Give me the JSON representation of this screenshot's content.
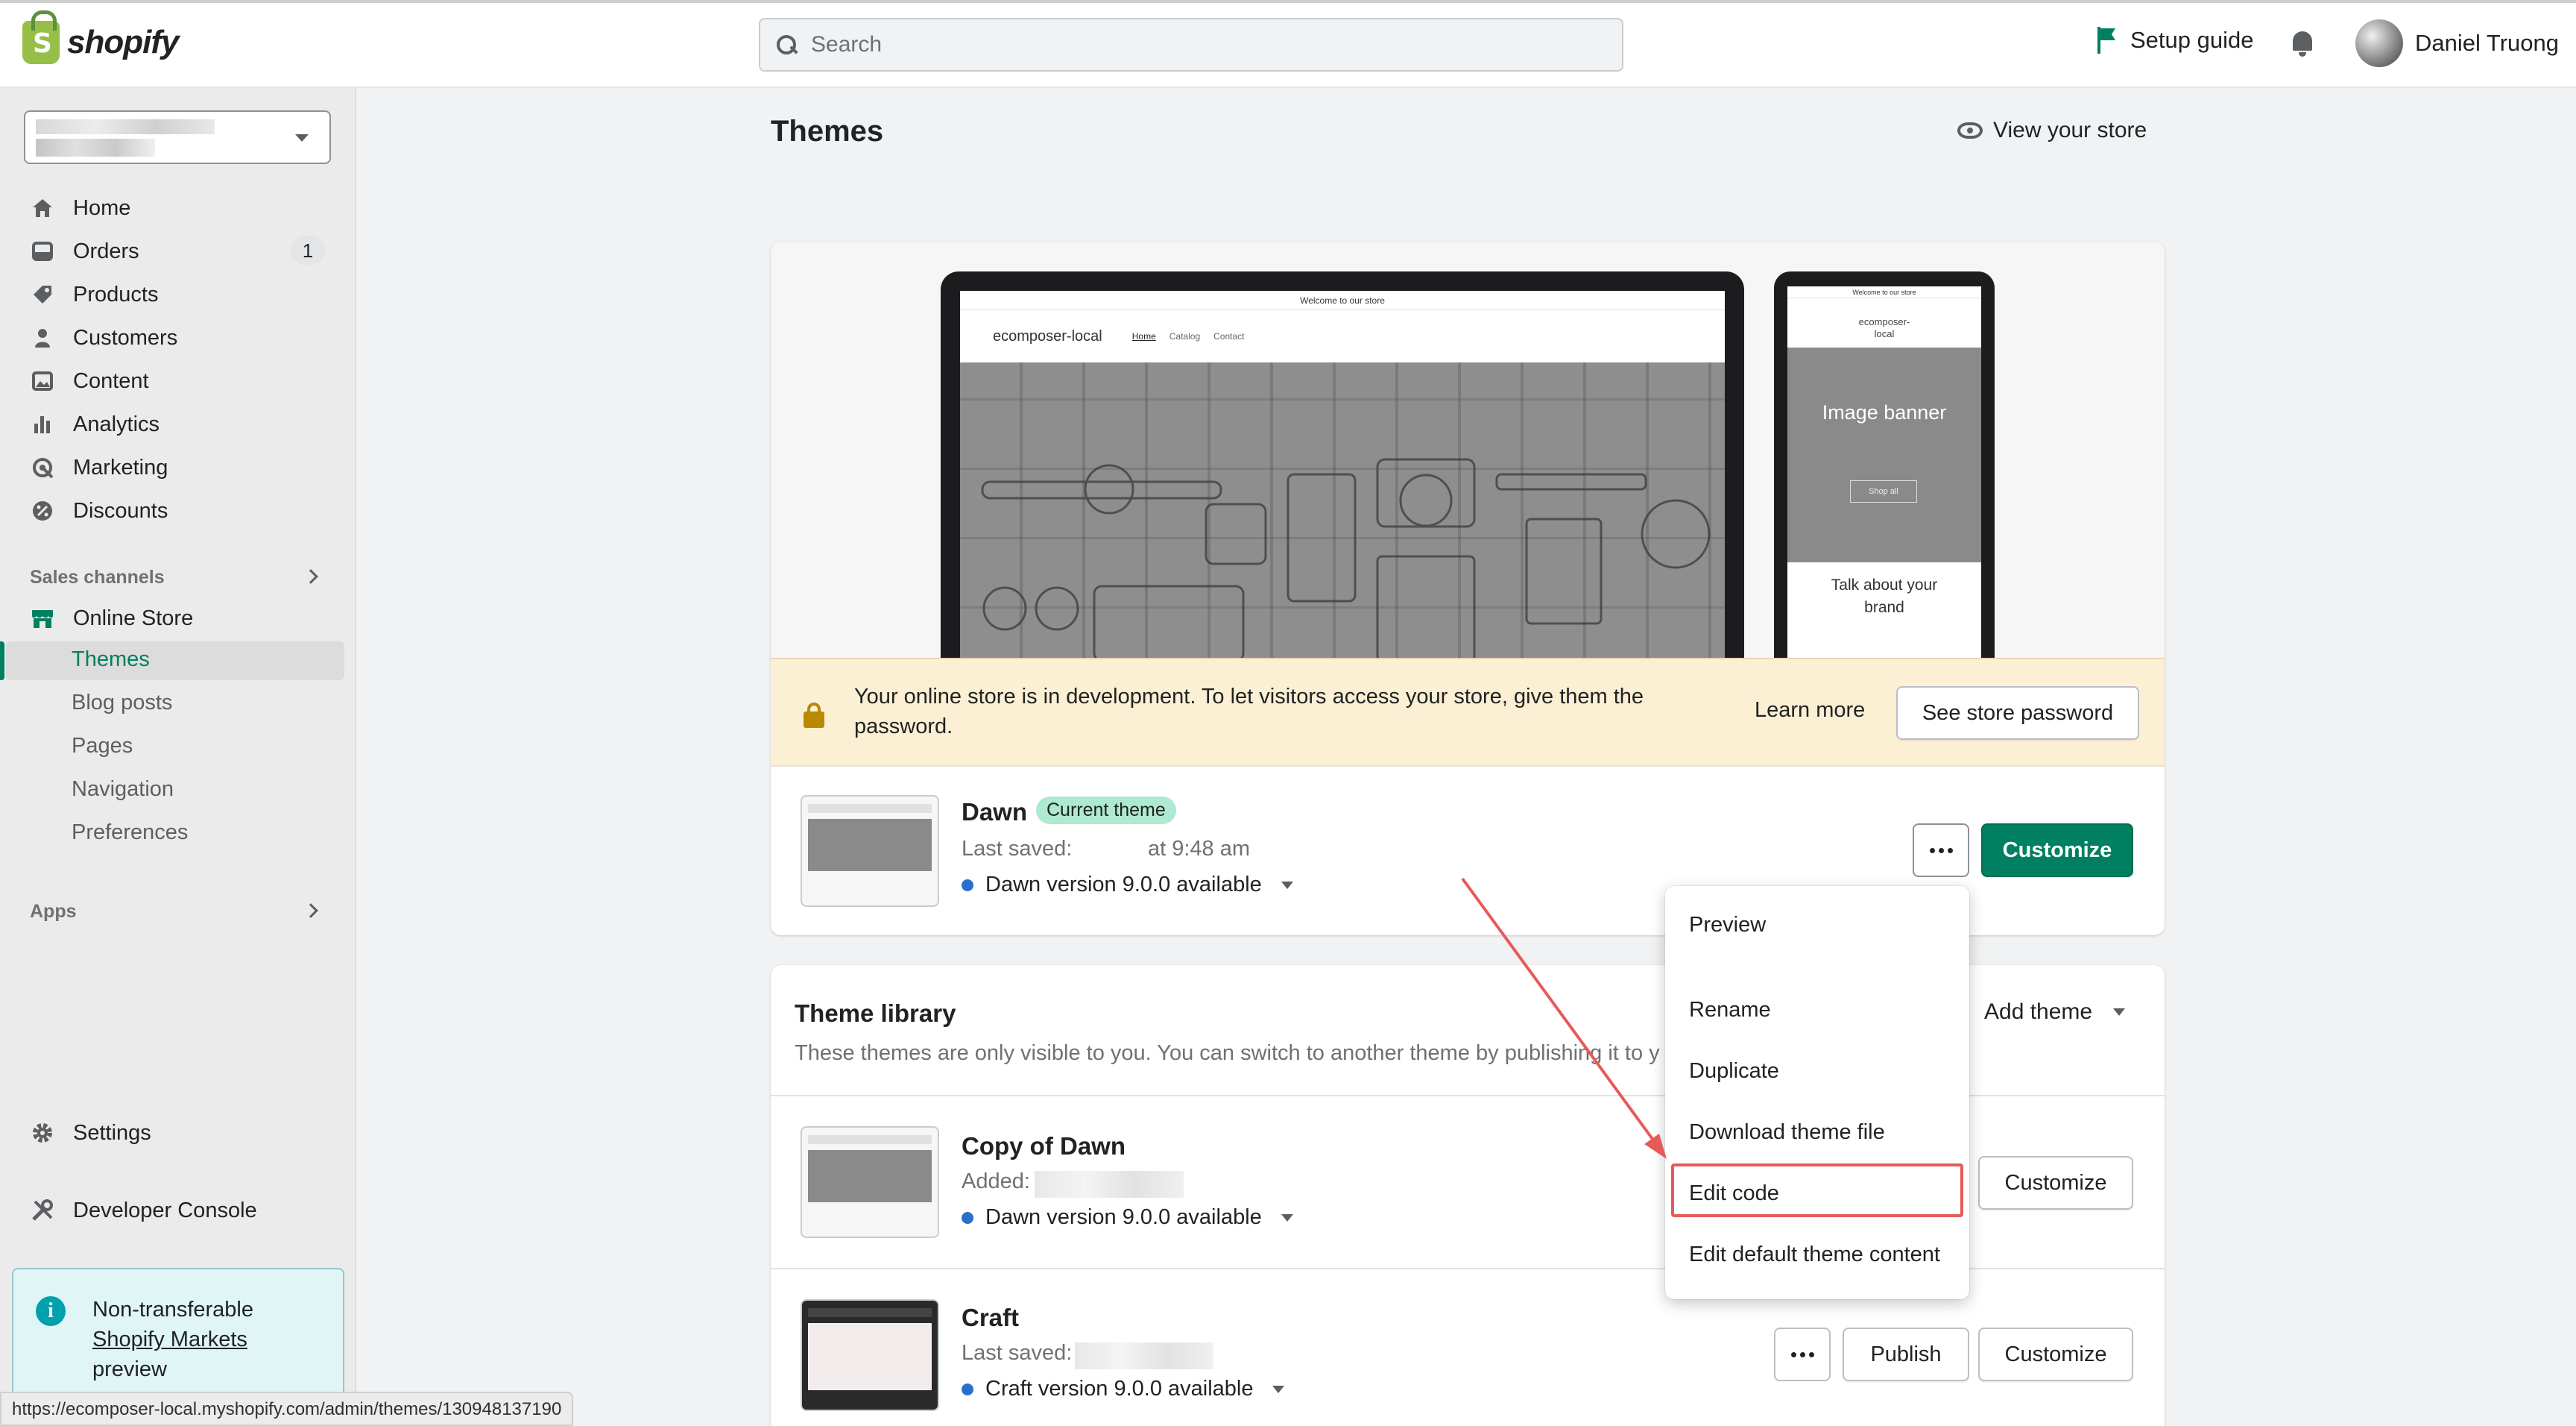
{
  "topbar": {
    "logo_text": "shopify",
    "search_placeholder": "Search",
    "setup_guide": "Setup guide",
    "user_name": "Daniel Truong"
  },
  "sidebar": {
    "items": [
      {
        "label": "Home",
        "icon": "home-icon"
      },
      {
        "label": "Orders",
        "icon": "orders-icon",
        "badge": "1"
      },
      {
        "label": "Products",
        "icon": "tag-icon"
      },
      {
        "label": "Customers",
        "icon": "person-icon"
      },
      {
        "label": "Content",
        "icon": "image-icon"
      },
      {
        "label": "Analytics",
        "icon": "bar-chart-icon"
      },
      {
        "label": "Marketing",
        "icon": "marketing-icon"
      },
      {
        "label": "Discounts",
        "icon": "discount-icon"
      }
    ],
    "sales_channels_label": "Sales channels",
    "online_store": "Online Store",
    "sub_items": [
      "Themes",
      "Blog posts",
      "Pages",
      "Navigation",
      "Preferences"
    ],
    "apps_label": "Apps",
    "settings": "Settings",
    "developer_console": "Developer Console",
    "notice_line1": "Non-transferable",
    "notice_link": "Shopify Markets",
    "notice_line3": "preview"
  },
  "status_url": "https://ecomposer-local.myshopify.com/admin/themes/130948137190",
  "main": {
    "title": "Themes",
    "view_store": "View your store",
    "preview": {
      "announcement": "Welcome to our store",
      "store_name": "ecomposer-local",
      "nav": [
        "Home",
        "Catalog",
        "Contact"
      ],
      "phone_announcement": "Welcome to our store",
      "phone_store_name": "ecomposer-\nlocal",
      "phone_hero_title": "Image banner",
      "phone_hero_button": "Shop all",
      "phone_talk": "Talk about your brand"
    },
    "dev_banner": {
      "text": "Your online store is in development. To let visitors access your store, give them the password.",
      "learn_more": "Learn more",
      "see_password": "See store password"
    },
    "current_theme": {
      "name": "Dawn",
      "badge": "Current theme",
      "last_saved_label": "Last saved:",
      "last_saved_time": "at 9:48 am",
      "version": "Dawn version 9.0.0 available",
      "customize": "Customize"
    },
    "library": {
      "title": "Theme library",
      "subtitle": "These themes are only visible to you. You can switch to another theme by publishing it to y",
      "add_theme": "Add theme",
      "themes": [
        {
          "name": "Copy of Dawn",
          "meta_label": "Added:",
          "version": "Dawn version 9.0.0 available",
          "customize": "Customize"
        },
        {
          "name": "Craft",
          "meta_label": "Last saved:",
          "version": "Craft version 9.0.0 available",
          "publish": "Publish",
          "customize": "Customize"
        }
      ]
    }
  },
  "menu": {
    "items": [
      "Preview",
      "Rename",
      "Duplicate",
      "Download theme file",
      "Edit code",
      "Edit default theme content"
    ],
    "highlighted": "Edit code"
  },
  "colors": {
    "brand_green": "#008060",
    "annotation_red": "#e75a5a",
    "banner_yellow": "#fcf0d4"
  }
}
